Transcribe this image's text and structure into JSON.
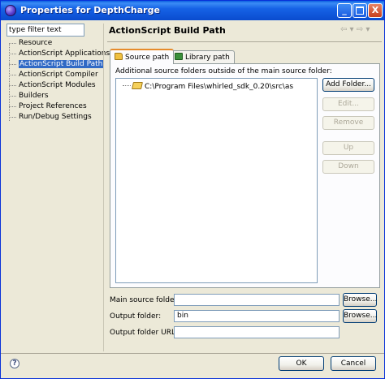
{
  "window": {
    "title": "Properties for DepthCharge",
    "minimize_label": "_",
    "close_label": "X"
  },
  "filter": {
    "value": "type filter text"
  },
  "nav": {
    "items": [
      {
        "label": "Resource",
        "selected": false
      },
      {
        "label": "ActionScript Applications",
        "selected": false
      },
      {
        "label": "ActionScript Build Path",
        "selected": true
      },
      {
        "label": "ActionScript Compiler",
        "selected": false
      },
      {
        "label": "ActionScript Modules",
        "selected": false
      },
      {
        "label": "Builders",
        "selected": false
      },
      {
        "label": "Project References",
        "selected": false
      },
      {
        "label": "Run/Debug Settings",
        "selected": false
      }
    ]
  },
  "page": {
    "title": "ActionScript Build Path",
    "back_arrow": "⇦ ▾",
    "forward_arrow": "⇨ ▾"
  },
  "tabs": [
    {
      "label": "Source path",
      "active": true
    },
    {
      "label": "Library path",
      "active": false
    }
  ],
  "source": {
    "label": "Additional source folders outside of the main source folder:",
    "folders": [
      "C:\\Program Files\\whirled_sdk_0.20\\src\\as"
    ],
    "buttons": {
      "add": "Add Folder...",
      "edit": "Edit...",
      "remove": "Remove",
      "up": "Up",
      "down": "Down"
    }
  },
  "fields": {
    "main_source_label": "Main source folder:",
    "main_source_value": "",
    "output_label": "Output folder:",
    "output_value": "bin",
    "output_url_label": "Output folder URL:",
    "output_url_value": "",
    "browse": "Browse..."
  },
  "footer": {
    "help": "?",
    "ok": "OK",
    "cancel": "Cancel"
  }
}
